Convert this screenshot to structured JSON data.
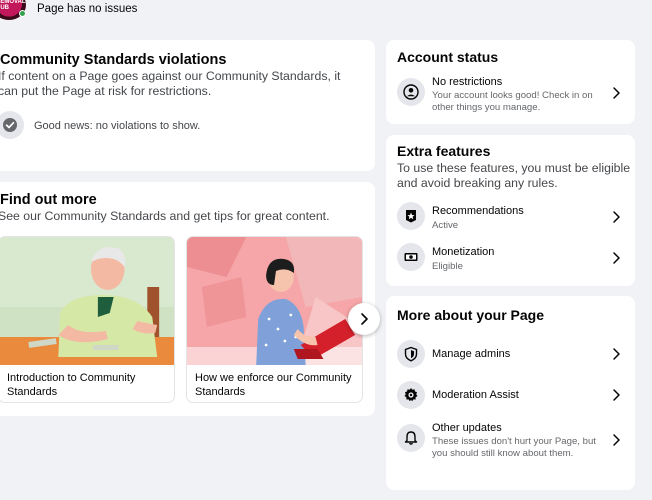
{
  "header": {
    "status_text": "Page has no issues",
    "logo_text": "REMOVAL HUB"
  },
  "violations": {
    "title": "Community Standards violations",
    "description": "If content on a Page goes against our Community Standards, it can put the Page at risk for restrictions.",
    "status": "Good news: no violations to show."
  },
  "find_out_more": {
    "title": "Find out more",
    "description": "See our Community Standards and get tips for great content.",
    "cards": [
      {
        "caption": "Introduction to Community Standards"
      },
      {
        "caption": "How we enforce our Community Standards"
      }
    ]
  },
  "account_status": {
    "title": "Account status",
    "item": {
      "title": "No restrictions",
      "subtitle": "Your account looks good! Check in on other things you manage."
    }
  },
  "extra_features": {
    "title": "Extra features",
    "description": "To use these features, you must be eligible and avoid breaking any rules.",
    "items": [
      {
        "title": "Recommendations",
        "status": "Active"
      },
      {
        "title": "Monetization",
        "status": "Eligible"
      }
    ]
  },
  "more_about": {
    "title": "More about your Page",
    "items": [
      {
        "title": "Manage admins"
      },
      {
        "title": "Moderation Assist"
      },
      {
        "title": "Other updates",
        "subtitle": "These issues don't hurt your Page, but you should still know about them."
      }
    ]
  },
  "colors": {
    "background": "#f0f2f5",
    "card": "#ffffff",
    "icon_bg": "#e4e6eb",
    "secondary_text": "#65676b",
    "status_green": "#31a24c"
  }
}
